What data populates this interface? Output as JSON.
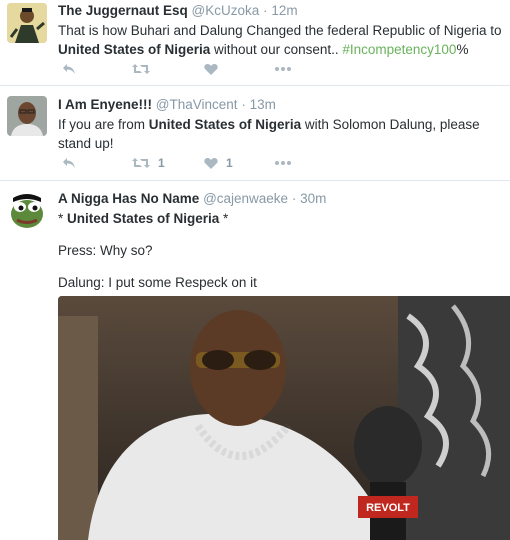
{
  "tweets": [
    {
      "name": "The Juggernaut Esq",
      "handle": "@KcUzoka",
      "separator": "·",
      "time": "12m",
      "text_part1": "That is how Buhari and Dalung Changed the federal Republic of Nigeria to ",
      "text_bold": "United States of Nigeria",
      "text_part2": " without our consent.. ",
      "hashtag": "#Incompetency100",
      "text_end": "%",
      "retweet_count": "",
      "like_count": "",
      "avatar_icon": "drawn-character-avatar-icon"
    },
    {
      "name": "I Am Enyene!!!",
      "handle": "@ThaVincent",
      "separator": "·",
      "time": "13m",
      "text_part1": "If you are from ",
      "text_bold": "United States of Nigeria",
      "text_part2": " with Solomon Dalung, please stand up!",
      "retweet_count": "1",
      "like_count": "1",
      "avatar_icon": "user-photo-avatar-icon"
    },
    {
      "name": "A Nigga Has No Name",
      "handle": "@cajenwaeke",
      "separator": "·",
      "time": "30m",
      "line1_prefix": "* ",
      "line1_bold": "United States of Nigeria",
      "line1_suffix": " *",
      "line2": "Press: Why so?",
      "line3": "Dalung: I put some Respeck on it",
      "avatar_icon": "pepe-frog-avatar-icon",
      "media_label": "REVOLT"
    }
  ],
  "colors": {
    "hashtag": "#68b35b",
    "muted": "#8899a6",
    "icon": "#aab8c2",
    "divider": "#e1e8ed"
  }
}
